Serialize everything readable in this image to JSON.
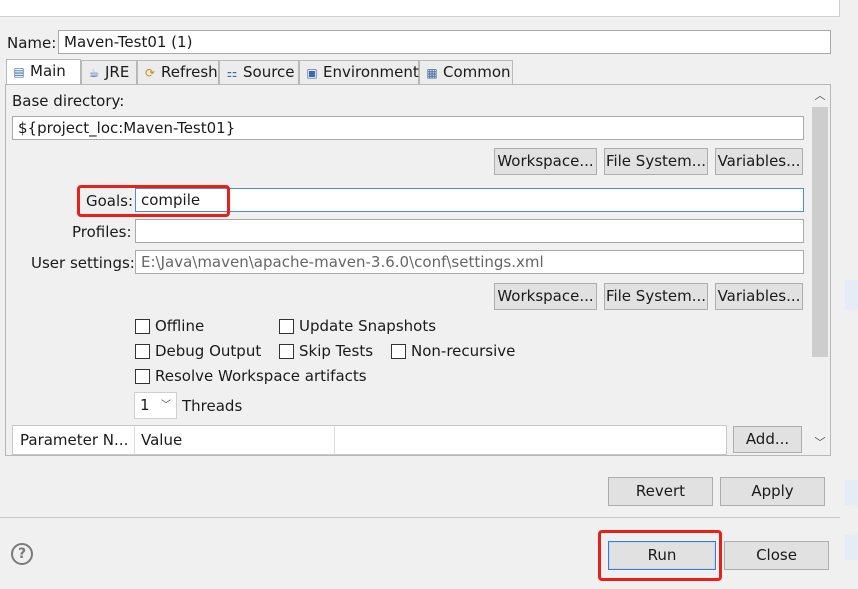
{
  "name_row": {
    "label": "Name:",
    "value": "Maven-Test01 (1)"
  },
  "tabs": [
    {
      "label": "Main",
      "icon": "main-tab-icon",
      "active": true
    },
    {
      "label": "JRE",
      "icon": "jre-icon"
    },
    {
      "label": "Refresh",
      "icon": "refresh-icon"
    },
    {
      "label": "Source",
      "icon": "source-icon"
    },
    {
      "label": "Environment",
      "icon": "environment-icon"
    },
    {
      "label": "Common",
      "icon": "common-icon"
    }
  ],
  "main": {
    "base_directory_label": "Base directory:",
    "base_directory_value": "${project_loc:Maven-Test01}",
    "buttons_top": {
      "workspace": "Workspace...",
      "file_system": "File System...",
      "variables": "Variables..."
    },
    "goals_label": "Goals:",
    "goals_value": "compile",
    "profiles_label": "Profiles:",
    "profiles_value": "",
    "user_settings_label": "User settings:",
    "user_settings_value": "E:\\Java\\maven\\apache-maven-3.6.0\\conf\\settings.xml",
    "buttons_bottom": {
      "workspace": "Workspace...",
      "file_system": "File System...",
      "variables": "Variables..."
    },
    "checkboxes": {
      "offline": "Offline",
      "update_snapshots": "Update Snapshots",
      "debug_output": "Debug Output",
      "skip_tests": "Skip Tests",
      "non_recursive": "Non-recursive",
      "resolve_workspace": "Resolve Workspace artifacts"
    },
    "threads_value": "1",
    "threads_label": "Threads",
    "param_table": {
      "col_name": "Parameter N...",
      "col_value": "Value"
    },
    "add_button": "Add..."
  },
  "footer": {
    "revert": "Revert",
    "apply": "Apply",
    "run": "Run",
    "close": "Close"
  },
  "colors": {
    "highlight": "#e8201a",
    "focus": "#4a90d9"
  }
}
